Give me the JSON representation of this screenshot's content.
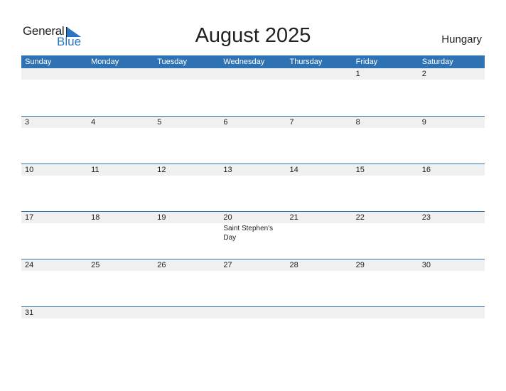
{
  "logo": {
    "general": "General",
    "blue": "Blue"
  },
  "title": "August 2025",
  "country": "Hungary",
  "colors": {
    "accent": "#2e72b3",
    "strip": "#f0f0f0",
    "logo_blue": "#2a76c1"
  },
  "weekdays": [
    "Sunday",
    "Monday",
    "Tuesday",
    "Wednesday",
    "Thursday",
    "Friday",
    "Saturday"
  ],
  "weeks": [
    [
      "",
      "",
      "",
      "",
      "",
      "1",
      "2"
    ],
    [
      "3",
      "4",
      "5",
      "6",
      "7",
      "8",
      "9"
    ],
    [
      "10",
      "11",
      "12",
      "13",
      "14",
      "15",
      "16"
    ],
    [
      "17",
      "18",
      "19",
      "20",
      "21",
      "22",
      "23"
    ],
    [
      "24",
      "25",
      "26",
      "27",
      "28",
      "29",
      "30"
    ],
    [
      "31",
      "",
      "",
      "",
      "",
      "",
      ""
    ]
  ],
  "holidays": [
    {
      "date": "20",
      "name": "Saint Stephen's Day"
    }
  ]
}
